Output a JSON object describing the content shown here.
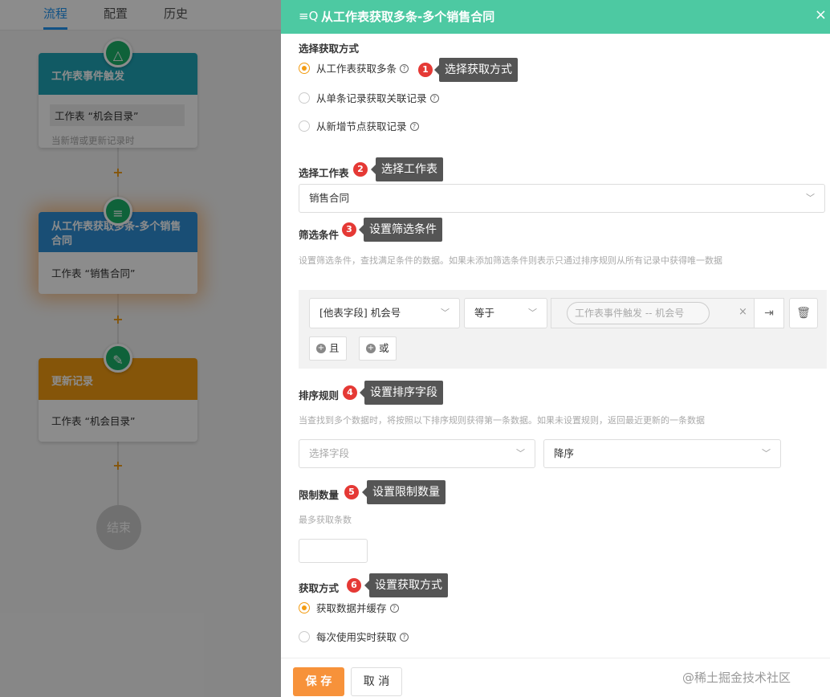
{
  "nav": {
    "tabs": [
      "流程",
      "配置",
      "历史"
    ],
    "active": 0
  },
  "flow": {
    "trigger": {
      "title": "工作表事件触发",
      "table": "工作表 “机会目录”",
      "sub": "当新增或更新记录时"
    },
    "fetch": {
      "title": "从工作表获取多条-多个销售合同",
      "table": "工作表 “销售合同”"
    },
    "update": {
      "title": "更新记录",
      "table": "工作表 “机会目录”"
    },
    "add_symbol": "+",
    "end": "结束"
  },
  "panel": {
    "title": "从工作表获取多条-多个销售合同",
    "close": "×",
    "fetch_method": {
      "label": "选择获取方式",
      "options": [
        "从工作表获取多条",
        "从单条记录获取关联记录",
        "从新增节点获取记录"
      ],
      "selected": 0
    },
    "worksheet": {
      "label": "选择工作表",
      "value": "销售合同"
    },
    "filter": {
      "label": "筛选条件",
      "hint": "设置筛选条件，查找满足条件的数据。如果未添加筛选条件则表示只通过排序规则从所有记录中获得唯一数据",
      "field": "[他表字段] 机会号",
      "operator": "等于",
      "value": "工作表事件触发 -- 机会号",
      "and_label": "且",
      "or_label": "或"
    },
    "sort": {
      "label": "排序规则",
      "hint": "当查找到多个数据时，将按照以下排序规则获得第一条数据。如果未设置规则，返回最近更新的一条数据",
      "field_placeholder": "选择字段",
      "order": "降序"
    },
    "limit": {
      "label": "限制数量",
      "hint": "最多获取条数",
      "value": ""
    },
    "retrieval": {
      "label": "获取方式",
      "options": [
        "获取数据并缓存",
        "每次使用实时获取"
      ],
      "selected": 0
    },
    "buttons": {
      "save": "保 存",
      "cancel": "取 消"
    },
    "watermark": "@稀土掘金技术社区"
  },
  "annotations": [
    {
      "n": "1",
      "text": "选择获取方式"
    },
    {
      "n": "2",
      "text": "选择工作表"
    },
    {
      "n": "3",
      "text": "设置筛选条件"
    },
    {
      "n": "4",
      "text": "设置排序字段"
    },
    {
      "n": "5",
      "text": "设置限制数量"
    },
    {
      "n": "6",
      "text": "设置获取方式"
    }
  ],
  "colors": {
    "header": "#4dc9a2",
    "accent": "#f39c12",
    "save": "#f7923a",
    "badge": "#e53935",
    "tab_active": "#2196f3"
  }
}
